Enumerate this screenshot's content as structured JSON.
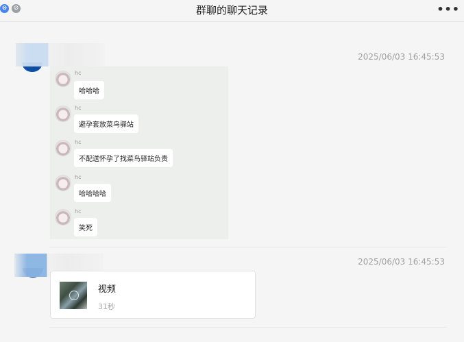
{
  "window": {
    "title": "群聊的聊天记录",
    "more_label": "•••"
  },
  "messages": [
    {
      "timestamp": "2025/06/03 16:45:53",
      "forwarded": [
        {
          "name": "hc",
          "text": "哈哈哈"
        },
        {
          "name": "hc",
          "text": "避孕套放菜鸟驿站"
        },
        {
          "name": "hc",
          "text": "不配送怀孕了找菜鸟驿站负责"
        },
        {
          "name": "hc",
          "text": "哈哈哈哈"
        },
        {
          "name": "hc",
          "text": "笑死"
        }
      ]
    },
    {
      "timestamp": "2025/06/03 16:45:53",
      "video": {
        "title": "视频",
        "duration": "31秒"
      }
    }
  ],
  "colors": {
    "accent": "#0d4fa6",
    "background": "#f5f5f5",
    "card": "#ecefec"
  }
}
